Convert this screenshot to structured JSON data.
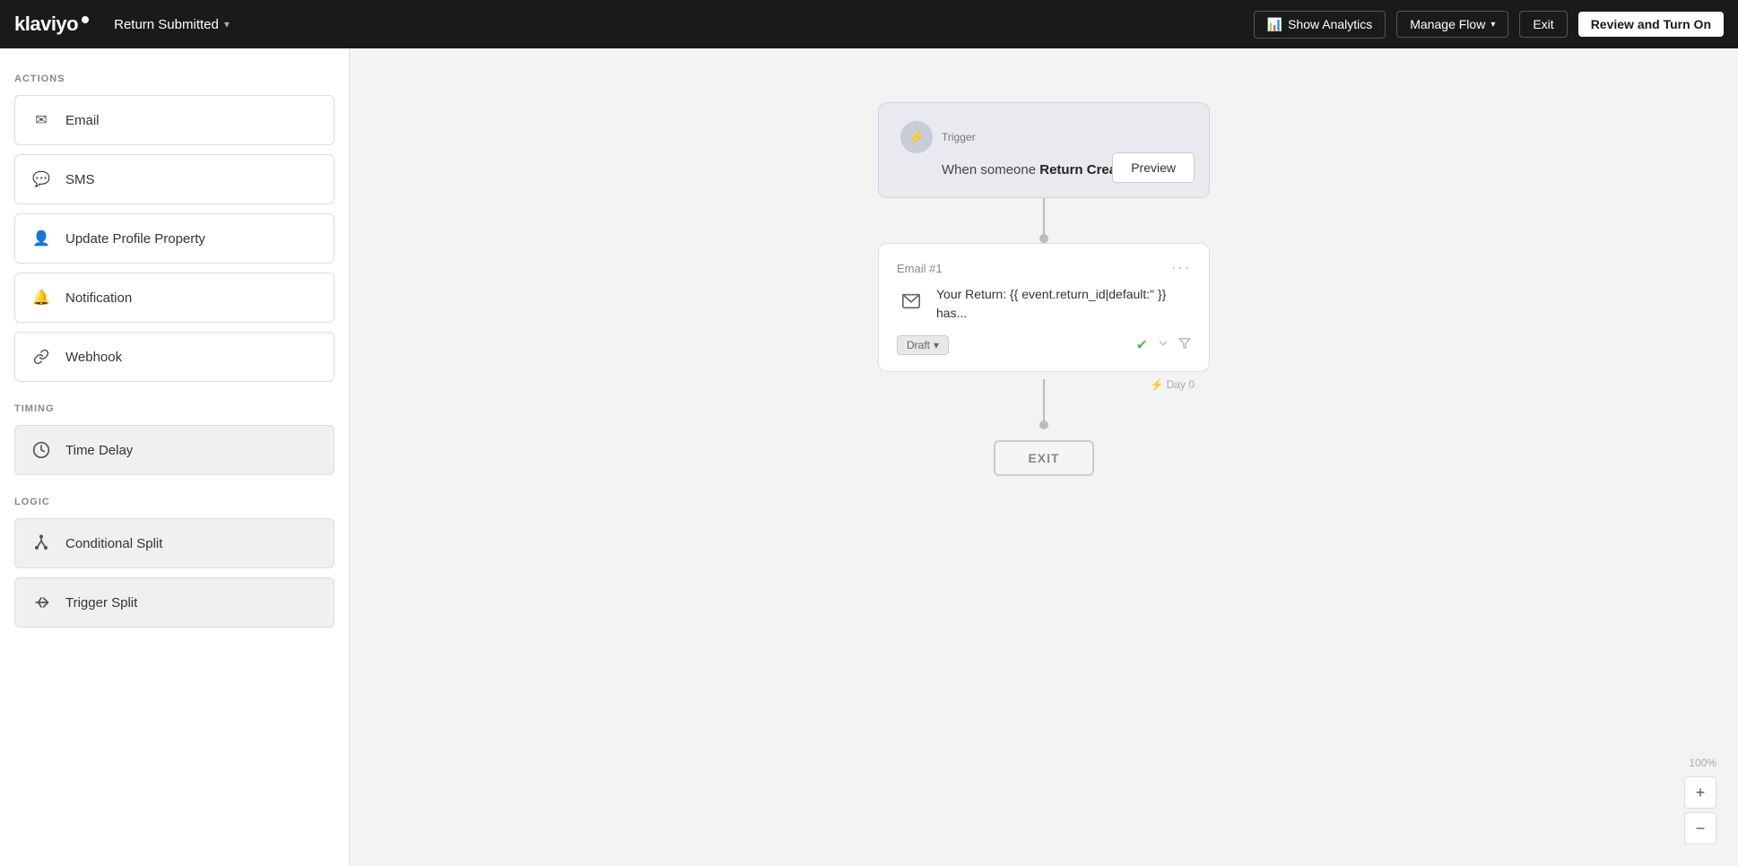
{
  "header": {
    "logo": "klaviyo",
    "flow_title": "Return Submitted",
    "show_analytics_label": "Show Analytics",
    "manage_flow_label": "Manage Flow",
    "exit_label": "Exit",
    "review_label": "Review and Turn On"
  },
  "sidebar": {
    "actions_label": "ACTIONS",
    "timing_label": "TIMING",
    "logic_label": "LOGIC",
    "items": {
      "actions": [
        {
          "id": "email",
          "label": "Email",
          "icon": "✉"
        },
        {
          "id": "sms",
          "label": "SMS",
          "icon": "💬"
        },
        {
          "id": "update-profile",
          "label": "Update Profile Property",
          "icon": "👤"
        },
        {
          "id": "notification",
          "label": "Notification",
          "icon": "🔔"
        },
        {
          "id": "webhook",
          "label": "Webhook",
          "icon": "🔗"
        }
      ],
      "timing": [
        {
          "id": "time-delay",
          "label": "Time Delay",
          "icon": "🕐"
        }
      ],
      "logic": [
        {
          "id": "conditional-split",
          "label": "Conditional Split",
          "icon": "⑂"
        },
        {
          "id": "trigger-split",
          "label": "Trigger Split",
          "icon": "⤴"
        }
      ]
    }
  },
  "canvas": {
    "trigger": {
      "label": "Trigger",
      "text_prefix": "When someone",
      "text_bold": "Return Created",
      "text_suffix": ".",
      "preview_label": "Preview"
    },
    "email_card": {
      "title": "Email #1",
      "subject": "Your Return: {{ event.return_id|default:\" }} has...",
      "status": "Draft",
      "day_label": "Day 0"
    },
    "exit_label": "EXIT"
  },
  "zoom": {
    "percent": "100%",
    "plus": "+",
    "minus": "−"
  }
}
